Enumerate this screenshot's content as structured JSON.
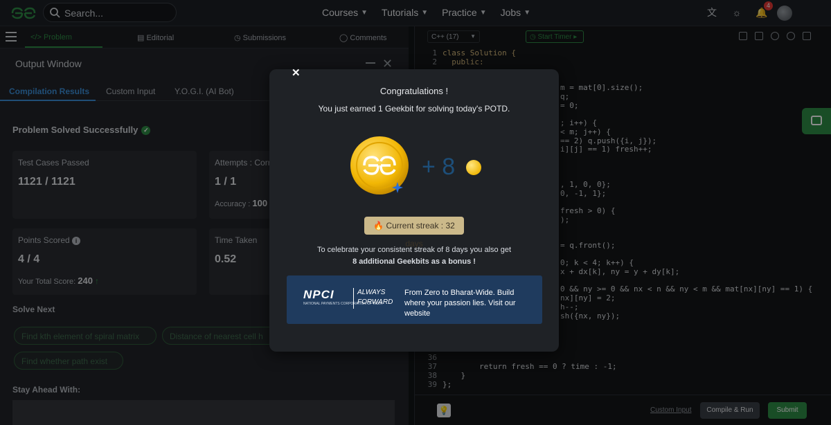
{
  "nav": {
    "search_placeholder": "Search...",
    "menu": [
      "Courses",
      "Tutorials",
      "Practice",
      "Jobs"
    ],
    "notification_count": "4"
  },
  "problem_tabs": [
    "Problem",
    "Editorial",
    "Submissions",
    "Comments"
  ],
  "output_window": {
    "title": "Output Window",
    "tabs": [
      "Compilation Results",
      "Custom Input",
      "Y.O.G.I. (AI Bot)"
    ],
    "status": "Problem Solved Successfully",
    "cards": {
      "test_cases_label": "Test Cases Passed",
      "test_cases_value": "1121 / 1121",
      "attempts_label": "Attempts : Corr",
      "attempts_value": "1 / 1",
      "accuracy_label": "Accuracy :",
      "accuracy_value": "100",
      "points_label": "Points Scored",
      "points_value": "4 / 4",
      "total_score_label": "Your Total Score:",
      "total_score_value": "240",
      "time_label": "Time Taken",
      "time_value": "0.52"
    },
    "solve_next_title": "Solve Next",
    "solve_next": [
      "Find kth element of spiral matrix",
      "Distance of nearest cell h",
      "Find whether path exist"
    ],
    "stay_ahead_title": "Stay Ahead With:"
  },
  "editor": {
    "language": "C++ (17)",
    "start_timer": "Start Timer",
    "lines": [
      {
        "n": "1",
        "code": "class Solution {"
      },
      {
        "n": "2",
        "code": "  public:"
      },
      {
        "n": "36",
        "code": ""
      },
      {
        "n": "37",
        "code": "        return fresh == 0 ? time : -1;"
      },
      {
        "n": "38",
        "code": "    }"
      },
      {
        "n": "39",
        "code": "};"
      }
    ],
    "visible_fragments": [
      "m = mat[0].size();",
      "q;",
      "= 0;",
      "; i++) {",
      "< m; j++) {",
      "== 2) q.push({i, j});",
      "i][j] == 1) fresh++;",
      ", 1, 0, 0};",
      "0, -1, 1};",
      "fresh > 0) {",
      ");",
      "= q.front();",
      "0; k < 4; k++) {",
      "x + dx[k], ny = y + dy[k];",
      "0 && ny >= 0 && nx < n && ny < m && mat[nx][ny] == 1) {",
      "nx][ny] = 2;",
      "h--;",
      "sh({nx, ny});"
    ],
    "custom_input": "Custom Input",
    "compile_run": "Compile & Run",
    "submit": "Submit"
  },
  "modal": {
    "title": "Congratulations !",
    "subtitle": "You just earned 1 Geekbit for solving today's POTD.",
    "plus_amount": "+ 8",
    "streak": "🔥 Current streak : 32 days",
    "celebrate_line1": "To celebrate your consistent streak of 8 days you also get",
    "celebrate_line2": "8 additional Geekbits as a bonus !",
    "ad_brand": "NPCI",
    "ad_brand_sub": "NATIONAL PAYMENTS CORPORATION OF INDIA",
    "ad_slogan1": "ALWAYS",
    "ad_slogan2": "FORWARD",
    "ad_text": "From Zero to Bharat-Wide. Build where your passion lies. Visit our website"
  },
  "colors": {
    "brand_green": "#2f8d46",
    "accent_blue": "#3b8fd9",
    "coin_gold": "#f0b90b"
  }
}
